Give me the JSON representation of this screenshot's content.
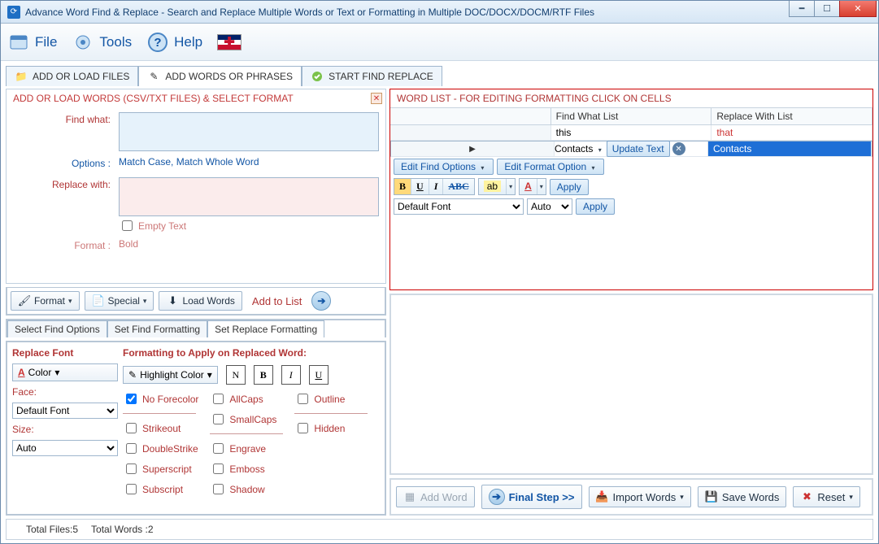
{
  "title": "Advance Word Find & Replace - Search and Replace Multiple Words or Text  or Formatting in Multiple DOC/DOCX/DOCM/RTF Files",
  "menu": {
    "file": "File",
    "tools": "Tools",
    "help": "Help"
  },
  "tabs": {
    "load": "ADD OR LOAD FILES",
    "words": "ADD WORDS OR PHRASES",
    "start": "START FIND REPLACE"
  },
  "left": {
    "panel_title": "ADD OR LOAD WORDS (CSV/TXT FILES) & SELECT FORMAT",
    "find_lbl": "Find what:",
    "options_lbl": "Options :",
    "options_val": "Match Case, Match Whole Word",
    "replace_lbl": "Replace with:",
    "empty_text": "Empty Text",
    "format_lbl": "Format :",
    "format_val": "Bold",
    "btn_format": "Format",
    "btn_special": "Special",
    "btn_load": "Load Words",
    "btn_addlist": "Add to List"
  },
  "subtabs": {
    "find_opts": "Select Find Options",
    "find_fmt": "Set Find Formatting",
    "repl_fmt": "Set Replace Formatting"
  },
  "repl": {
    "font_title": "Replace Font",
    "color_btn": "Color",
    "face_lbl": "Face:",
    "face_val": "Default Font",
    "size_lbl": "Size:",
    "size_val": "Auto",
    "fmt_title": "Formatting to Apply on Replaced Word:",
    "hl_btn": "Highlight Color",
    "n": "N",
    "b": "B",
    "i": "I",
    "u": "U",
    "chk": {
      "nofore": "No Forecolor",
      "strike": "Strikeout",
      "dbl": "DoubleStrike",
      "sup": "Superscript",
      "sub": "Subscript",
      "allcaps": "AllCaps",
      "smallcaps": "SmallCaps",
      "engrave": "Engrave",
      "emboss": "Emboss",
      "shadow": "Shadow",
      "outline": "Outline",
      "hidden": "Hidden"
    }
  },
  "right": {
    "title": "WORD LIST - FOR EDITING FORMATTING CLICK ON CELLS",
    "col_find": "Find What List",
    "col_repl": "Replace With List",
    "rows": [
      {
        "find": "this",
        "replace": "that"
      },
      {
        "find": "Contacts",
        "replace": "Contacts"
      }
    ],
    "update_text": "Update Text",
    "edit_find": "Edit Find Options",
    "edit_fmt": "Edit Format Option",
    "apply": "Apply",
    "font_default": "Default Font",
    "auto": "Auto"
  },
  "bottom": {
    "add_word": "Add Word",
    "final": "Final Step >>",
    "import": "Import Words",
    "save": "Save Words",
    "reset": "Reset"
  },
  "status": {
    "files": "Total Files:5",
    "words": "Total Words :2"
  }
}
